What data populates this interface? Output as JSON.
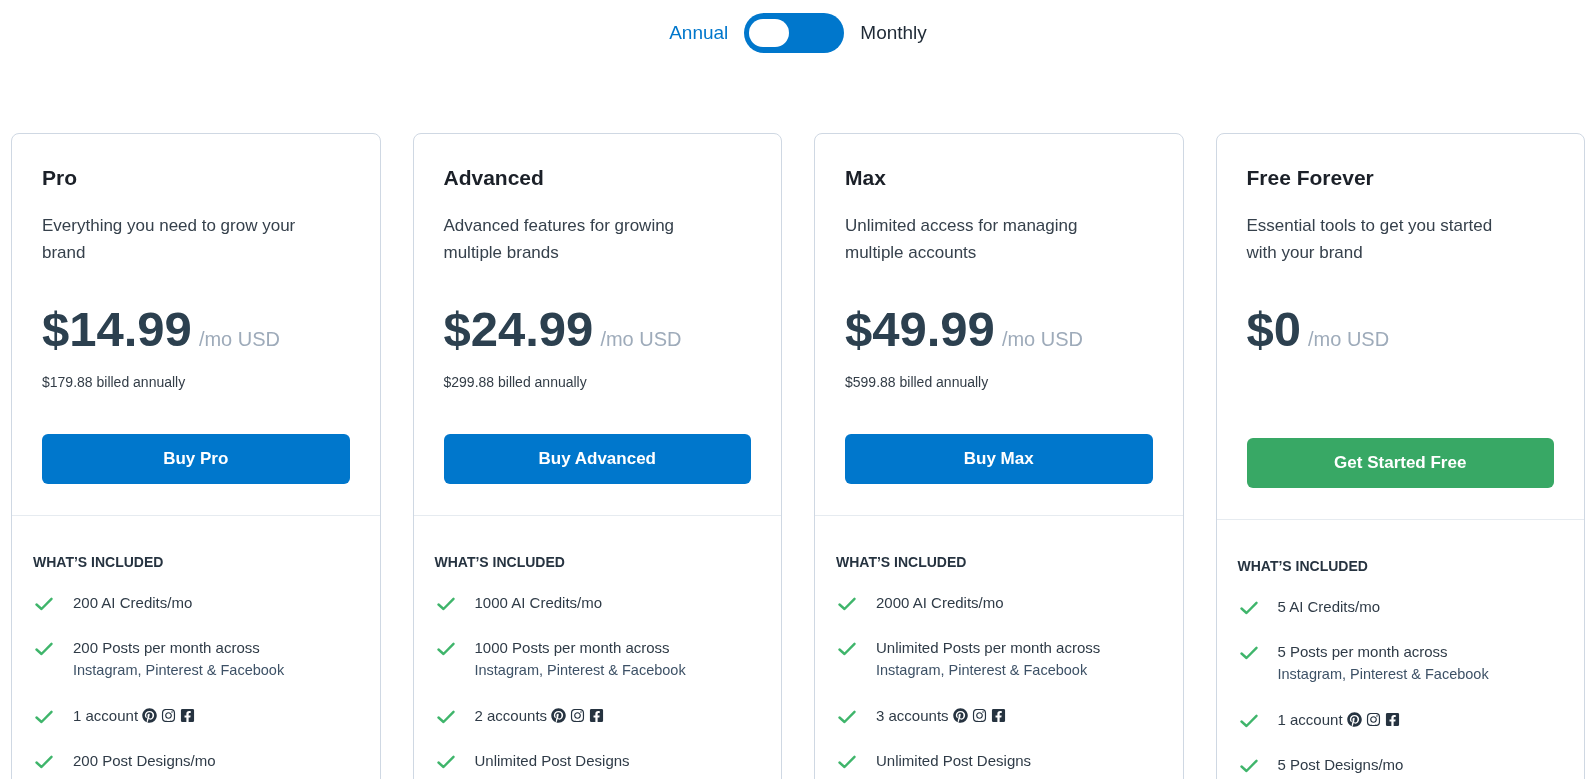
{
  "billing": {
    "options": [
      {
        "label": "Annual",
        "selected": true
      },
      {
        "label": "Monthly",
        "selected": false
      }
    ]
  },
  "plans": [
    {
      "name": "Pro",
      "description": "Everything you need to grow your brand",
      "price": "$14.99",
      "period": "/mo USD",
      "billed": "$179.88 billed annually",
      "button": {
        "label": "Buy Pro",
        "kind": "primary"
      },
      "features_heading": "WHAT’S INCLUDED",
      "features": [
        {
          "kind": "plain",
          "text": "200 AI Credits/mo"
        },
        {
          "kind": "platforms",
          "text": "200 Posts per month across",
          "platforms": "Instagram, Pinterest & Facebook"
        },
        {
          "kind": "accounts",
          "text": "1 account"
        },
        {
          "kind": "plain",
          "text": "200 Post Designs/mo"
        }
      ]
    },
    {
      "name": "Advanced",
      "description": "Advanced features for growing multiple brands",
      "price": "$24.99",
      "period": "/mo USD",
      "billed": "$299.88 billed annually",
      "button": {
        "label": "Buy Advanced",
        "kind": "primary"
      },
      "features_heading": "WHAT’S INCLUDED",
      "features": [
        {
          "kind": "plain",
          "text": "1000 AI Credits/mo"
        },
        {
          "kind": "platforms",
          "text": "1000 Posts per month across",
          "platforms": "Instagram, Pinterest & Facebook"
        },
        {
          "kind": "accounts",
          "text": "2 accounts"
        },
        {
          "kind": "plain",
          "text": "Unlimited Post Designs"
        }
      ]
    },
    {
      "name": "Max",
      "description": "Unlimited access for managing multiple accounts",
      "price": "$49.99",
      "period": "/mo USD",
      "billed": "$599.88 billed annually",
      "button": {
        "label": "Buy Max",
        "kind": "primary"
      },
      "features_heading": "WHAT’S INCLUDED",
      "features": [
        {
          "kind": "plain",
          "text": "2000 AI Credits/mo"
        },
        {
          "kind": "platforms",
          "text": "Unlimited Posts per month across",
          "platforms": "Instagram, Pinterest & Facebook"
        },
        {
          "kind": "accounts",
          "text": "3 accounts"
        },
        {
          "kind": "plain",
          "text": "Unlimited Post Designs"
        }
      ]
    },
    {
      "name": "Free Forever",
      "description": "Essential tools to get you started with your brand",
      "price": "$0",
      "period": "/mo USD",
      "button": {
        "label": "Get Started Free",
        "kind": "success"
      },
      "features_heading": "WHAT’S INCLUDED",
      "features": [
        {
          "kind": "plain",
          "text": "5 AI Credits/mo"
        },
        {
          "kind": "platforms",
          "text": "5 Posts per month across",
          "platforms": "Instagram, Pinterest & Facebook"
        },
        {
          "kind": "accounts",
          "text": "1 account"
        },
        {
          "kind": "plain",
          "text": "5 Post Designs/mo"
        }
      ]
    }
  ]
}
